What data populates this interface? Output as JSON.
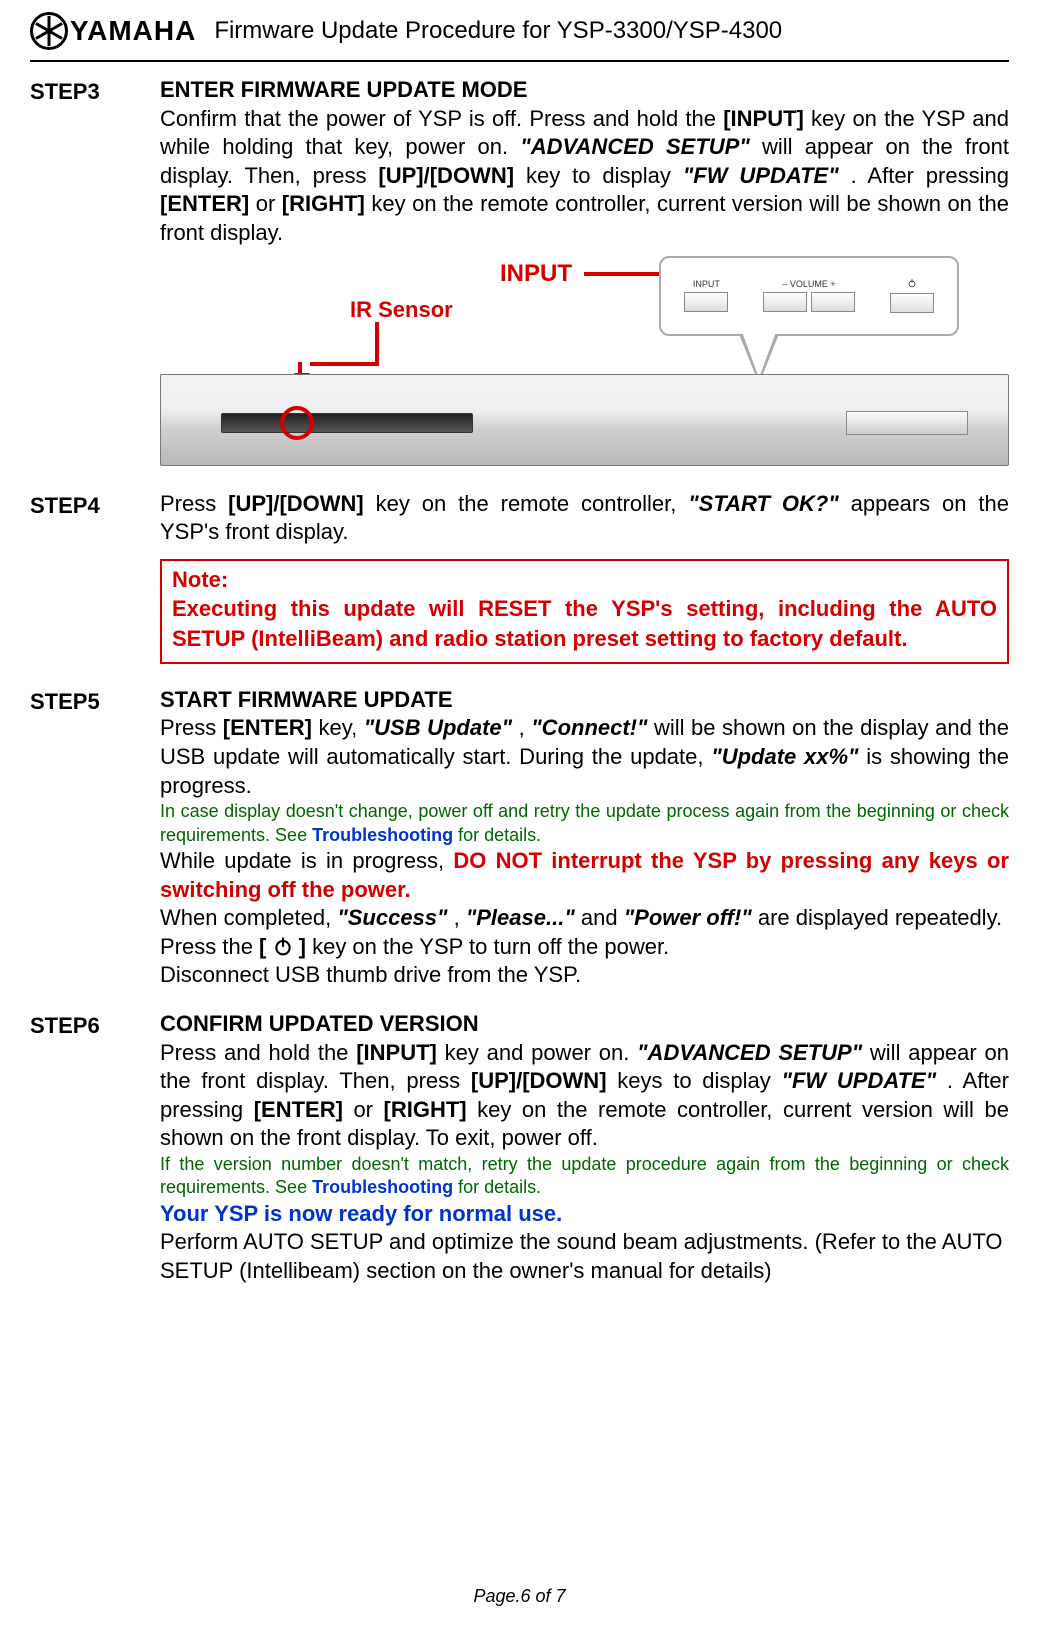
{
  "header": {
    "logo_text": "YAMAHA",
    "doc_title": "Firmware Update Procedure for YSP-3300/YSP-4300"
  },
  "diagram": {
    "ir_sensor_label": "IR Sensor",
    "input_label": "INPUT",
    "bubble_input": "INPUT",
    "bubble_vol_minus": "–  VOLUME  +",
    "bubble_power": "⏻"
  },
  "steps": {
    "s3": {
      "label": "STEP3",
      "heading": "ENTER FIRMWARE UPDATE MODE",
      "t1": "Confirm that the power of YSP is off. Press and hold the ",
      "k_input": "[INPUT]",
      "t2": " key on the YSP and while holding that key, power on. ",
      "q_adv": "\"ADVANCED SETUP\"",
      "t3": " will appear on the front display. Then, press ",
      "k_updown": "[UP]/[DOWN]",
      "t4": " key to display ",
      "q_fw": "\"FW UPDATE\"",
      "t5": ". After pressing ",
      "k_enter": "[ENTER]",
      "t6": " or ",
      "k_right": "[RIGHT]",
      "t7": " key on the remote controller, current version will be shown on the front display."
    },
    "s4": {
      "label": "STEP4",
      "t1": "Press ",
      "k_updown": "[UP]/[DOWN]",
      "t2": " key on the remote controller, ",
      "q_start": "\"START OK?\"",
      "t3": " appears on the YSP's front display.",
      "note_title": "Note:",
      "note_body": "Executing this update will RESET the YSP's setting, including the AUTO SETUP (IntelliBeam) and radio station preset setting to factory default."
    },
    "s5": {
      "label": "STEP5",
      "heading": "START FIRMWARE UPDATE",
      "p1a": "Press ",
      "k_enter": "[ENTER]",
      "p1b": " key, ",
      "q_usb": "\"USB Update\"",
      "p1c": ", ",
      "q_conn": "\"Connect!\"",
      "p1d": " will be shown on the display and the USB update will automatically start. During the update, ",
      "q_upd": "\"Update xx%\"",
      "p1e": " is showing the progress.",
      "green1a": "In case display doesn't change, power off and retry the update process again from the beginning or check requirements. See ",
      "troubleshooting": "Troubleshooting",
      "green1b": " for details.",
      "p2a": "While update is in progress, ",
      "warn": "DO NOT interrupt the YSP by pressing any keys or switching off the power.",
      "p3a": "When completed, ",
      "q_succ": "\"Success\"",
      "p3b": ", ",
      "q_pls": "\"Please...\"",
      "p3c": " and ",
      "q_pow": "\"Power off!\"",
      "p3d": " are displayed repeatedly. Press the ",
      "brL": "[ ",
      "brR": " ]",
      "p3e": " key on the YSP to turn off the power.",
      "p4": "Disconnect USB thumb drive from the YSP."
    },
    "s6": {
      "label": "STEP6",
      "heading": "CONFIRM UPDATED VERSION",
      "p1a": "Press and hold the ",
      "k_input": "[INPUT]",
      "p1b": " key and power on. ",
      "q_adv": "\"ADVANCED SETUP\"",
      "p1c": " will appear on the front display. Then, press ",
      "k_updown": "[UP]/[DOWN]",
      "p1d": " keys to display ",
      "q_fw": "\"FW UPDATE\"",
      "p1e": ". After pressing ",
      "k_enter": "[ENTER]",
      "p1f": " or ",
      "k_right": "[RIGHT]",
      "p1g": " key on the remote controller, current version will be shown on the front display. To exit, power off.",
      "green1a": "If the version number doesn't match, retry the update procedure again from the beginning or check requirements. See ",
      "troubleshooting": "Troubleshooting",
      "green1b": " for details.",
      "ready": "Your YSP is now ready for normal use.",
      "p2": "Perform AUTO SETUP and optimize the sound beam adjustments. (Refer to the AUTO SETUP (Intellibeam) section on the owner's manual for details)"
    }
  },
  "footer": "Page.6 of 7"
}
